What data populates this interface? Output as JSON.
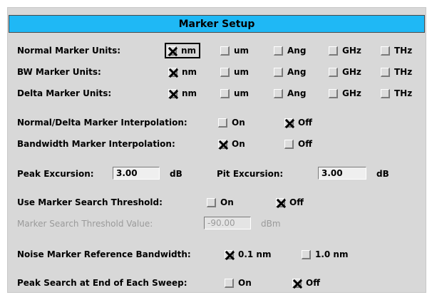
{
  "title": "Marker Setup",
  "units_options": [
    "nm",
    "um",
    "Ang",
    "GHz",
    "THz"
  ],
  "rows": {
    "normal_units": {
      "label": "Normal Marker Units:",
      "selected": "nm"
    },
    "bw_units": {
      "label": "BW Marker Units:",
      "selected": "nm"
    },
    "delta_units": {
      "label": "Delta Marker Units:",
      "selected": "nm"
    },
    "nd_interp": {
      "label": "Normal/Delta Marker Interpolation:",
      "on": "On",
      "off": "Off",
      "selected": "Off"
    },
    "bw_interp": {
      "label": "Bandwidth Marker Interpolation:",
      "on": "On",
      "off": "Off",
      "selected": "On"
    },
    "peak_excursion": {
      "label": "Peak Excursion:",
      "value": "3.00",
      "unit": "dB"
    },
    "pit_excursion": {
      "label": "Pit Excursion:",
      "value": "3.00",
      "unit": "dB"
    },
    "use_threshold": {
      "label": "Use Marker Search Threshold:",
      "on": "On",
      "off": "Off",
      "selected": "Off"
    },
    "threshold_value": {
      "label": "Marker Search Threshold Value:",
      "value": "-90.00",
      "unit": "dBm"
    },
    "noise_bw": {
      "label": "Noise Marker Reference Bandwidth:",
      "opt1": "0.1 nm",
      "opt2": "1.0 nm",
      "selected": "0.1 nm"
    },
    "peak_search_end": {
      "label": "Peak Search at End of Each Sweep:",
      "on": "On",
      "off": "Off",
      "selected": "Off"
    }
  }
}
